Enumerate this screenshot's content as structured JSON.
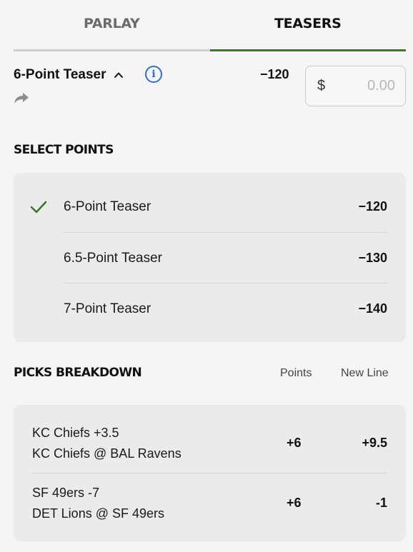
{
  "tabs": [
    {
      "label": "PARLAY",
      "active": false
    },
    {
      "label": "TEASERS",
      "active": true
    }
  ],
  "teaser": {
    "title": "6-Point Teaser",
    "odds": "−120",
    "currency_symbol": "$",
    "wager_placeholder": "0.00"
  },
  "select_points": {
    "heading": "SELECT POINTS",
    "options": [
      {
        "label": "6-Point Teaser",
        "odds": "−120",
        "selected": true
      },
      {
        "label": "6.5-Point Teaser",
        "odds": "−130",
        "selected": false
      },
      {
        "label": "7-Point Teaser",
        "odds": "−140",
        "selected": false
      }
    ]
  },
  "picks_breakdown": {
    "heading": "PICKS BREAKDOWN",
    "col_points": "Points",
    "col_new_line": "New Line",
    "picks": [
      {
        "selection": "KC Chiefs +3.5",
        "game": "KC Chiefs @ BAL Ravens",
        "points": "+6",
        "new_line": "+9.5"
      },
      {
        "selection": "SF 49ers -7",
        "game": "DET Lions @ SF 49ers",
        "points": "+6",
        "new_line": "-1"
      }
    ]
  },
  "colors": {
    "accent_green": "#3b7a23",
    "info_blue": "#2f6ed8"
  },
  "icons": {
    "expand": "chevron-up-icon",
    "info": "info-icon",
    "share": "share-arrow-icon",
    "selected": "checkmark-icon"
  }
}
